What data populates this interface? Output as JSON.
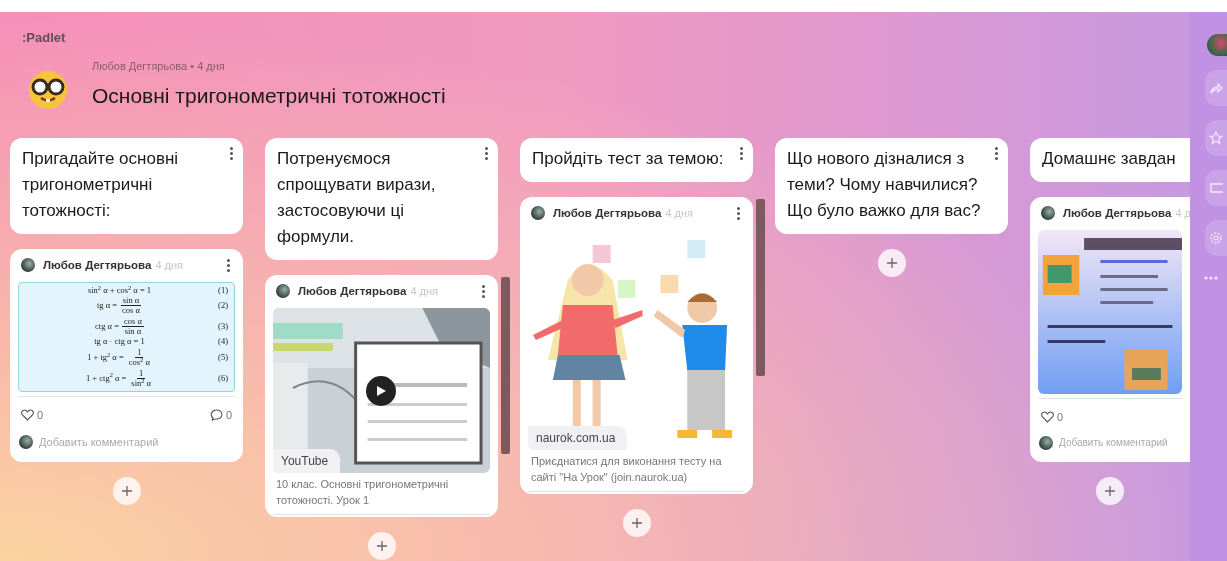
{
  "brand": ":Padlet",
  "board": {
    "author_line": "Любов Дегтярьова • 4 дня",
    "title": "Основні тригонометричні тотожності"
  },
  "columns": [
    {
      "title": "Пригадайте основні тригонометричні тотожності:",
      "posts": [
        {
          "author": "Любов Дегтярьова",
          "time": "4 дня",
          "attachment": {
            "kind": "formulas",
            "lines": [
              {
                "lhs": "sin$^{2}$ α + cos$^{2}$ α = 1",
                "number": "(1)"
              },
              {
                "lhs": "tg α =",
                "num": "sin α",
                "den": "cos α",
                "number": "(2)"
              },
              {
                "lhs": "ctg α =",
                "num": "cos α",
                "den": "sin α",
                "number": "(3)"
              },
              {
                "lhs": "tg α · ctg α = 1",
                "number": "(4)"
              },
              {
                "lhs": "1 + tg$^{2}$ α =",
                "num": "1",
                "den": "cos$^{2}$ α",
                "number": "(5)"
              },
              {
                "lhs": "1 + ctg$^{2}$ α =",
                "num": "1",
                "den": "sin$^{2}$ α",
                "number": "(6)"
              }
            ]
          },
          "likes": "0",
          "comments": "0",
          "comment_placeholder": "Добавить комментарий"
        }
      ]
    },
    {
      "title": "Потренуємося спрощувати вирази, застосовуючи ці формули.",
      "posts": [
        {
          "author": "Любов Дегтярьова",
          "time": "4 дня",
          "attachment": {
            "kind": "video",
            "label": "YouTube"
          },
          "caption": "10 клас. Основні тригонометричні тотожності. Урок 1",
          "scrollbar": true
        }
      ]
    },
    {
      "title": "Пройдіть тест за темою:",
      "posts": [
        {
          "author": "Любов Дегтярьова",
          "time": "4 дня",
          "attachment": {
            "kind": "illustration",
            "label": "naurok.com.ua"
          },
          "caption": "Приєднатися для виконання тесту на сайті \"На Урок\" (join.naurok.ua)",
          "scrollbar": true
        }
      ]
    },
    {
      "title": "Що нового дізналися з теми? Чому навчилися? Що було важко для вас?"
    },
    {
      "title": "Домашнє завдан",
      "cut": true,
      "posts": [
        {
          "author": "Любов Дегтярьова",
          "time": "4 д",
          "likes": "0",
          "comment_placeholder": "Добавить комментарий"
        }
      ]
    }
  ]
}
